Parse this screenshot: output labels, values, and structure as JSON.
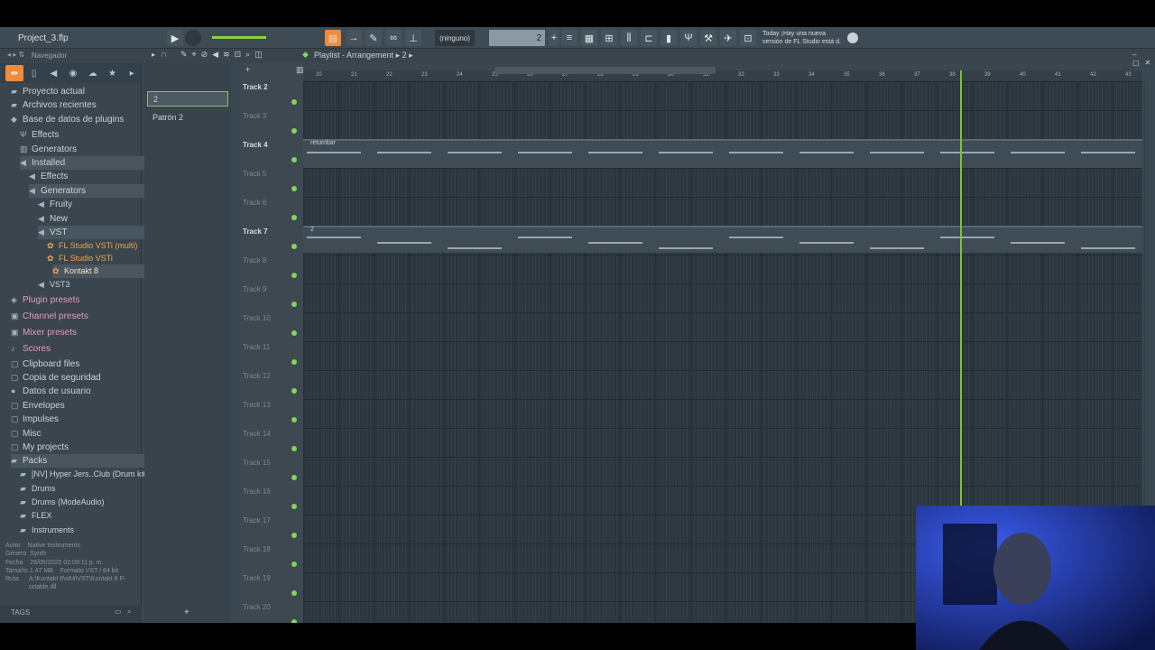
{
  "window": {
    "title": "Project_3.flp"
  },
  "toolbar": {
    "pattern_value": "2",
    "preset": "(ninguno)",
    "news_line1": "Today ¡Hay una nueva",
    "news_line2": "versión de FL Studio está d.",
    "play_icon": "play-icon",
    "record_icon": "record-icon"
  },
  "browser": {
    "title": "Navegador",
    "items": [
      {
        "label": "Proyecto actual",
        "indent": 0
      },
      {
        "label": "Archivos recientes",
        "indent": 0
      },
      {
        "label": "Base de datos de plugins",
        "indent": 0
      },
      {
        "label": "Effects",
        "indent": 1
      },
      {
        "label": "Generators",
        "indent": 1
      },
      {
        "label": "Installed",
        "indent": 1
      },
      {
        "label": "Effects",
        "indent": 2
      },
      {
        "label": "Generators",
        "indent": 2
      },
      {
        "label": "Fruity",
        "indent": 3
      },
      {
        "label": "New",
        "indent": 3
      },
      {
        "label": "VST",
        "indent": 3
      },
      {
        "label": "FL Studio VSTi (multi)",
        "indent": 4
      },
      {
        "label": "FL Studio VSTi",
        "indent": 4
      },
      {
        "label": "Kontakt 8",
        "indent": 5
      },
      {
        "label": "VST3",
        "indent": 3
      },
      {
        "label": "Plugin presets",
        "indent": 0
      },
      {
        "label": "Channel presets",
        "indent": 0
      },
      {
        "label": "Mixer presets",
        "indent": 0
      },
      {
        "label": "Scores",
        "indent": 0
      },
      {
        "label": "Clipboard files",
        "indent": 0
      },
      {
        "label": "Copia de seguridad",
        "indent": 0
      },
      {
        "label": "Datos de usuario",
        "indent": 0
      },
      {
        "label": "Envelopes",
        "indent": 0
      },
      {
        "label": "Impulses",
        "indent": 0
      },
      {
        "label": "Misc",
        "indent": 0
      },
      {
        "label": "My projects",
        "indent": 0
      },
      {
        "label": "Packs",
        "indent": 0
      },
      {
        "label": "[NV] Hyper Jers..Club (Drum kit)",
        "indent": 1
      },
      {
        "label": "Drums",
        "indent": 1
      },
      {
        "label": "Drums (ModeAudio)",
        "indent": 1
      },
      {
        "label": "FLEX",
        "indent": 1
      },
      {
        "label": "Instruments",
        "indent": 1
      }
    ],
    "info": {
      "autor_label": "Autor",
      "autor": "Native Instruments",
      "genero_label": "Género",
      "genero": "Synth",
      "fecha_label": "Fecha",
      "fecha": "26/05/2025 02:09:11 p. m.",
      "tamano_label": "Tamaño",
      "tamano": "1.47 MB",
      "formato_label": "Formato",
      "formato": "VST / 64 bit",
      "ruta_label": "Ruta",
      "ruta": "A:\\Kontakt 8\\x64\\VST\\Kontakt 8 P-ortable.dll"
    },
    "tags": "TAGS"
  },
  "patterns": [
    "2",
    "Patrón 2"
  ],
  "playlist": {
    "title": "Playlist - Arrangement",
    "current": "2",
    "tracks": [
      "Track 2",
      "Track 3",
      "Track 4",
      "Track 5",
      "Track 6",
      "Track 7",
      "Track 8",
      "Track 9",
      "Track 10",
      "Track 11",
      "Track 12",
      "Track 13",
      "Track 14",
      "Track 15",
      "Track 16",
      "Track 17",
      "Track 18",
      "Track 19",
      "Track 20"
    ],
    "ruler": [
      "20",
      "21",
      "22",
      "23",
      "24",
      "25",
      "26",
      "27",
      "28",
      "29",
      "30",
      "31",
      "32",
      "33",
      "34",
      "35",
      "36",
      "37",
      "38",
      "39",
      "40",
      "41",
      "42",
      "43"
    ],
    "clips": [
      {
        "label": "retumbar",
        "track": "Track 4"
      },
      {
        "label": "2",
        "track": "Track 7"
      }
    ]
  },
  "colors": {
    "accent": "#f08a3c",
    "led": "#7fd65b",
    "playhead": "#7fc234"
  }
}
